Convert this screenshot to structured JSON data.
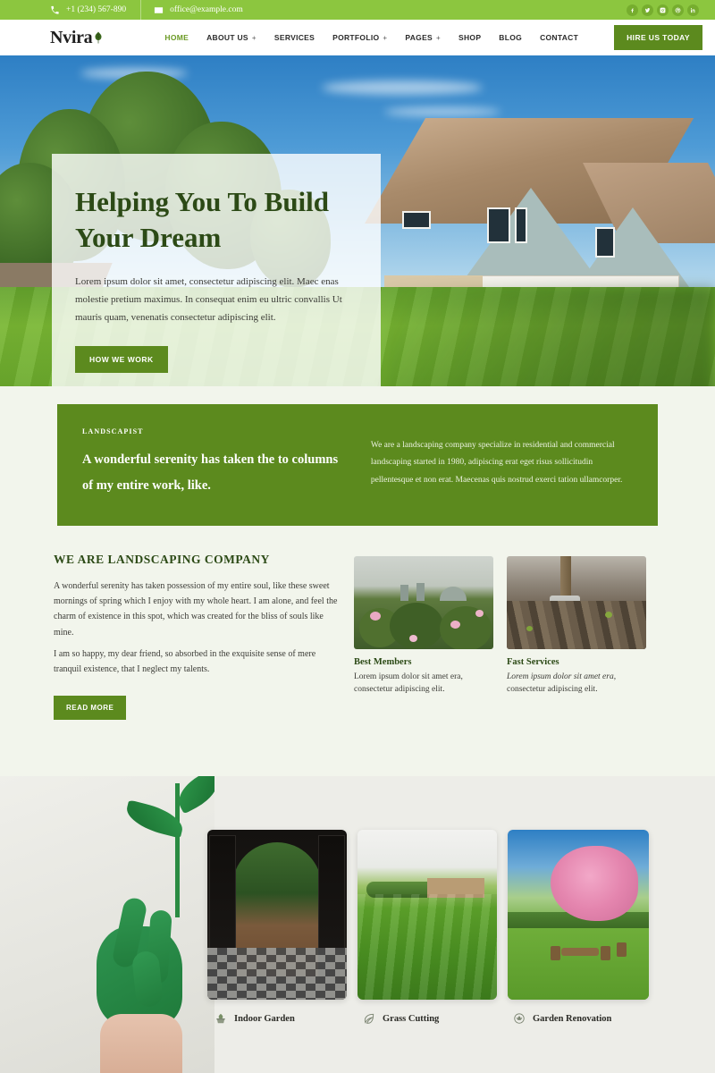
{
  "topbar": {
    "phone": "+1 (234) 567-890",
    "email": "office@example.com",
    "phone_icon": "phone-icon",
    "email_icon": "envelope-icon",
    "socials": [
      {
        "name": "facebook-icon",
        "glyph": "f"
      },
      {
        "name": "twitter-icon",
        "glyph": "t"
      },
      {
        "name": "instagram-icon",
        "glyph": "i"
      },
      {
        "name": "dribbble-icon",
        "glyph": "d"
      },
      {
        "name": "linkedin-icon",
        "glyph": "in"
      }
    ]
  },
  "header": {
    "logo_text": "Nvira",
    "logo_icon": "leaf-logo-icon",
    "nav": [
      {
        "label": "HOME",
        "has_submenu": false,
        "active": true
      },
      {
        "label": "ABOUT US",
        "has_submenu": true,
        "active": false
      },
      {
        "label": "SERVICES",
        "has_submenu": false,
        "active": false
      },
      {
        "label": "PORTFOLIO",
        "has_submenu": true,
        "active": false
      },
      {
        "label": "PAGES",
        "has_submenu": true,
        "active": false
      },
      {
        "label": "SHOP",
        "has_submenu": false,
        "active": false
      },
      {
        "label": "BLOG",
        "has_submenu": false,
        "active": false
      },
      {
        "label": "CONTACT",
        "has_submenu": false,
        "active": false
      }
    ],
    "cta_label": "HIRE US TODAY",
    "submenu_marker": "+"
  },
  "hero": {
    "title": "Helping You To Build Your Dream",
    "paragraph": "Lorem ipsum dolor sit amet, consectetur adipiscing elit. Maec enas molestie pretium maximus. In consequat enim eu ultric convallis Ut mauris quam, venenatis consectetur adipiscing elit.",
    "button_label": "HOW WE WORK",
    "image_alt": "suburban-house-with-lawn"
  },
  "quote": {
    "label": "LANDSCAPIST",
    "heading": "A wonderful serenity has taken  the to columns of my entire work, like.",
    "body": "We are a landscaping company specialize in residential and commercial landscaping started in 1980, adipiscing erat eget risus sollicitudin pellentesque et non erat. Maecenas quis nostrud exerci tation ullamcorper."
  },
  "about": {
    "title": "WE ARE LANDSCAPING COMPANY",
    "paragraph_1": "A wonderful serenity has taken possession of my entire soul, like these sweet mornings of spring which I enjoy with my whole heart. I am alone, and feel the charm of existence in this spot, which was created for the bliss of souls like mine.",
    "paragraph_2": "I am so happy, my dear friend, so absorbed in the exquisite sense of mere tranquil existence, that I neglect my talents.",
    "button_label": "READ MORE",
    "features": [
      {
        "title": "Best Members",
        "text": "Lorem ipsum dolor sit amet era, consectetur adipiscing elit.",
        "image_alt": "flower-garden-photo"
      },
      {
        "title": "Fast Services",
        "text": "Lorem ipsum dolor sit amet era, consectetur adipiscing elit.",
        "image_alt": "spade-in-soil-photo"
      }
    ]
  },
  "gallery": {
    "hand_image_alt": "green-painted-hand-holding-plant",
    "items": [
      {
        "label": "Indoor Garden",
        "icon": "potted-plant-icon",
        "image_alt": "arched-doorway-to-indoor-garden"
      },
      {
        "label": "Grass Cutting",
        "icon": "leaf-icon",
        "image_alt": "mown-green-lawn-field"
      },
      {
        "label": "Garden Renovation",
        "icon": "flower-icon",
        "image_alt": "garden-with-cherry-blossom-tree"
      }
    ]
  },
  "colors": {
    "top_bar_green": "#8CC63F",
    "brand_green": "#5C8A1E",
    "nav_active_green": "#6B9A24",
    "heading_dark_green": "#2C4A16",
    "about_bg": "#F2F5EC",
    "gallery_bg": "#EDEDE8"
  }
}
